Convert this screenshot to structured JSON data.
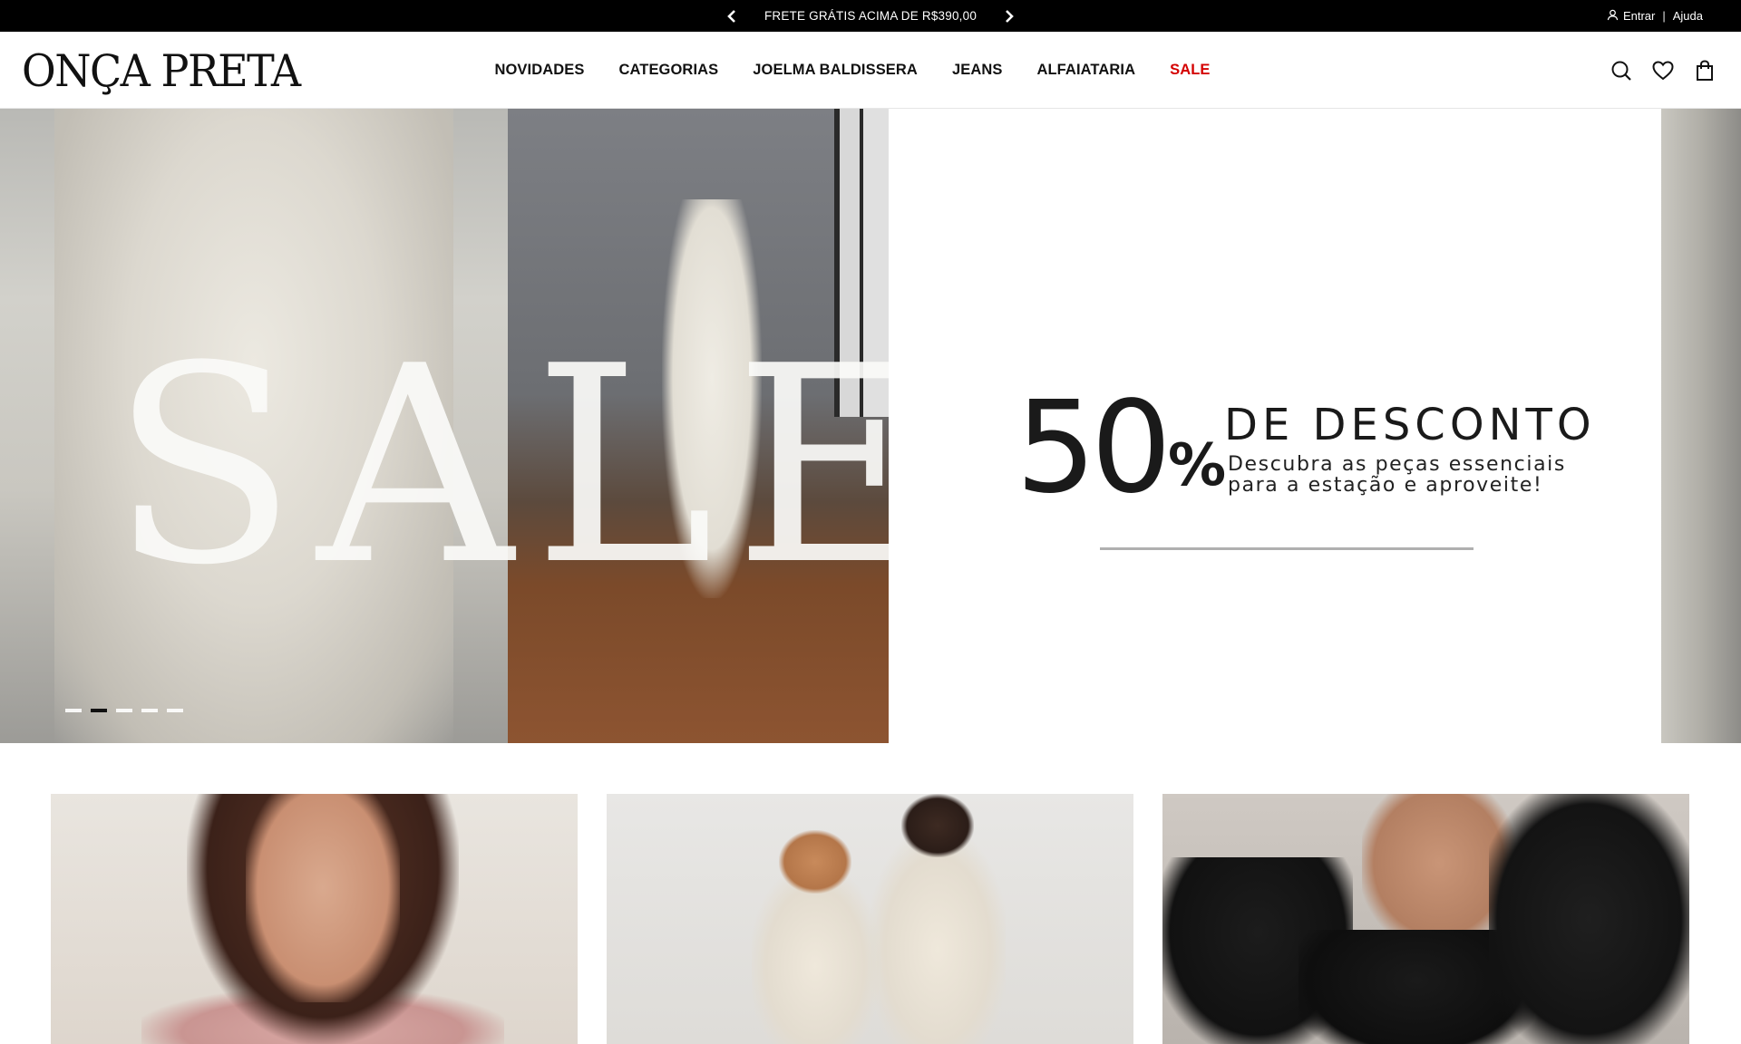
{
  "topbar": {
    "promo_text": "FRETE GRÁTIS ACIMA DE R$390,00",
    "prev_icon": "chevron-left-icon",
    "next_icon": "chevron-right-icon",
    "login_label": "Entrar",
    "separator": "|",
    "help_label": "Ajuda"
  },
  "header": {
    "logo": "ONÇA PRETA",
    "nav": [
      "NOVIDADES",
      "CATEGORIAS",
      "JOELMA BALDISSERA",
      "JEANS",
      "ALFAIATARIA",
      "SALE"
    ],
    "sale_color": "#d40000",
    "icons": [
      "search-icon",
      "heart-icon",
      "bag-icon"
    ]
  },
  "hero": {
    "sale_word": "SALE",
    "percent": "50",
    "percent_sign": "%",
    "headline": "DE DESCONTO",
    "sub_line1": "Descubra as peças essenciais",
    "sub_line2": "para a estação e aproveite!",
    "slides_total": 5,
    "active_slide": 2
  },
  "cards": [
    {
      "name": "category-card-1"
    },
    {
      "name": "category-card-2"
    },
    {
      "name": "category-card-3"
    }
  ]
}
